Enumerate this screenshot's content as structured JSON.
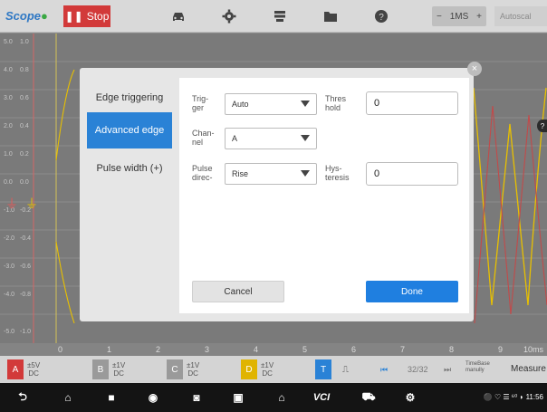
{
  "app": {
    "brand": "Scope",
    "stop_label": "Stop"
  },
  "toolbar": {
    "icons": [
      "car-icon",
      "gear-icon",
      "stack-icon",
      "folder-icon",
      "help-icon"
    ],
    "timebase_minus": "−",
    "timebase_value": "1MS",
    "timebase_plus": "+",
    "autoscale": "Autoscal"
  },
  "y_axis_a": [
    "5.0",
    "4.0",
    "3.0",
    "2.0",
    "1.0",
    "0.0",
    "-1.0",
    "-2.0",
    "-3.0",
    "-4.0",
    "-5.0"
  ],
  "y_axis_b": [
    "1.0",
    "0.8",
    "0.6",
    "0.4",
    "0.2",
    "0.0",
    "-0.2",
    "-0.4",
    "-0.6",
    "-0.8",
    "-1.0"
  ],
  "x_axis": [
    "0",
    "1",
    "2",
    "3",
    "4",
    "5",
    "6",
    "7",
    "8",
    "9",
    "10ms"
  ],
  "dialog": {
    "tabs": [
      "Edge triggering",
      "Advanced edge",
      "Pulse width (+)"
    ],
    "active_tab": 1,
    "fields": {
      "trigger_label": "Trig-\nger",
      "trigger_value": "Auto",
      "threshold_label": "Thres\nhold",
      "threshold_value": "0",
      "channel_label": "Chan-\nnel",
      "channel_value": "A",
      "pulse_label": "Pulse\ndirec-",
      "pulse_value": "Rise",
      "hysteresis_label": "Hys-\nteresis",
      "hysteresis_value": "0"
    },
    "cancel": "Cancel",
    "done": "Done",
    "close": "×"
  },
  "channels": [
    {
      "id": "A",
      "range": "±5V",
      "coupling": "DC",
      "color": "#d23a3a"
    },
    {
      "id": "B",
      "range": "±1V",
      "coupling": "DC",
      "color": "#9a9a9a"
    },
    {
      "id": "C",
      "range": "±1V",
      "coupling": "DC",
      "color": "#9a9a9a"
    },
    {
      "id": "D",
      "range": "±1V",
      "coupling": "DC",
      "color": "#e0b400"
    }
  ],
  "trigger_bar": {
    "t_label": "T",
    "pulse_icon": "pulse-icon",
    "page": "32/32",
    "timebase_text": "TimeBase\nmanully",
    "measure": "Measure"
  },
  "status": {
    "text": "⚫ ♡ ☰ ⁶⁰ ◗ 11:56"
  },
  "colors": {
    "accent": "#2a82d6",
    "stop": "#d23a3a",
    "trace_a": "#d94a4a",
    "trace_d": "#e8c000"
  }
}
